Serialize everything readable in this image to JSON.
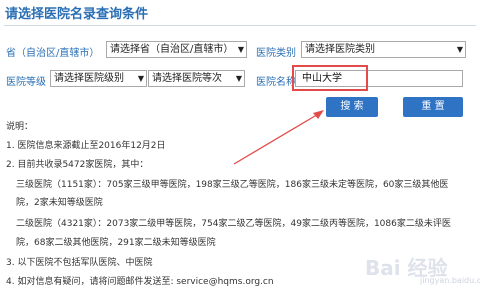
{
  "page": {
    "title": "请选择医院名录查询条件"
  },
  "form": {
    "province_label": "省（自治区/直辖市）",
    "province_value": "请选择省（自治区/直辖市）",
    "category_label": "医院类别",
    "category_value": "请选择医院类别",
    "level_label": "医院等级",
    "level_value": "请选择医院级别",
    "grade_value": "请选择医院等次",
    "name_label": "医院名称",
    "name_value": "中山大学",
    "search_label": "搜 索",
    "reset_label": "重 置"
  },
  "notes": {
    "heading": "说明：",
    "l1": "1. 医院信息来源截止至2016年12月2日",
    "l2": "2. 目前共收录5472家医院，其中：",
    "l3": "三级医院（1151家）：705家三级甲等医院，198家三级乙等医院，186家三级未定等医院，60家三级其他医",
    "l4": "院，2家未知等级医院",
    "l5": "二级医院（4321家）：2073家二级甲等医院，754家二级乙等医院，49家二级丙等医院，1086家二级未评医",
    "l6": "院，68家二级其他医院，291家二级未知等级医院",
    "l7": "3. 以下医院不包括军队医院、中医院",
    "l8": "4. 如对信息有疑问，请将问题邮件发送至: service@hqms.org.cn"
  },
  "watermark": {
    "text": "Bai 经验",
    "sub": "jingyan.baidu.com"
  },
  "colors": {
    "accent": "#2a6fb5",
    "button": "#2f73c5",
    "highlight": "#e34b4b"
  }
}
